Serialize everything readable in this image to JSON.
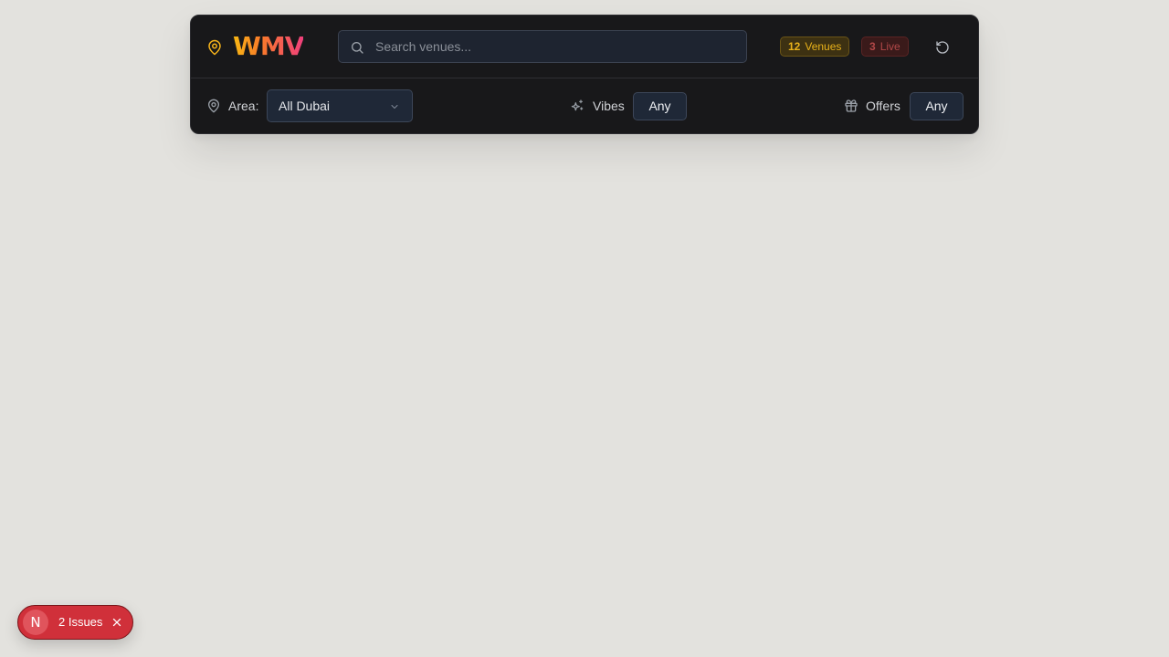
{
  "header": {
    "logo_text": "WMV",
    "search": {
      "placeholder": "Search venues...",
      "value": ""
    },
    "badges": {
      "venues_count": "12",
      "venues_label": "Venues",
      "live_count": "3",
      "live_label": "Live"
    },
    "icons": [
      "map-pin-icon",
      "search-icon",
      "reset-icon"
    ]
  },
  "filters": {
    "area_label": "Area:",
    "area_value": "All Dubai",
    "vibes_label": "Vibes",
    "vibes_value": "Any",
    "offers_label": "Offers",
    "offers_value": "Any",
    "icons": [
      "map-pin-icon",
      "sparkles-icon",
      "gift-icon",
      "chevron-down-icon"
    ]
  },
  "dev_overlay": {
    "logo_letter": "N",
    "issues_text": "2 Issues"
  },
  "colors": {
    "background": "#e3e2de",
    "panel": "#18181a",
    "accent_yellow": "#e9b21a",
    "accent_pink": "#f0407c",
    "live_red": "#b14848",
    "issues_red": "#d0303a"
  }
}
